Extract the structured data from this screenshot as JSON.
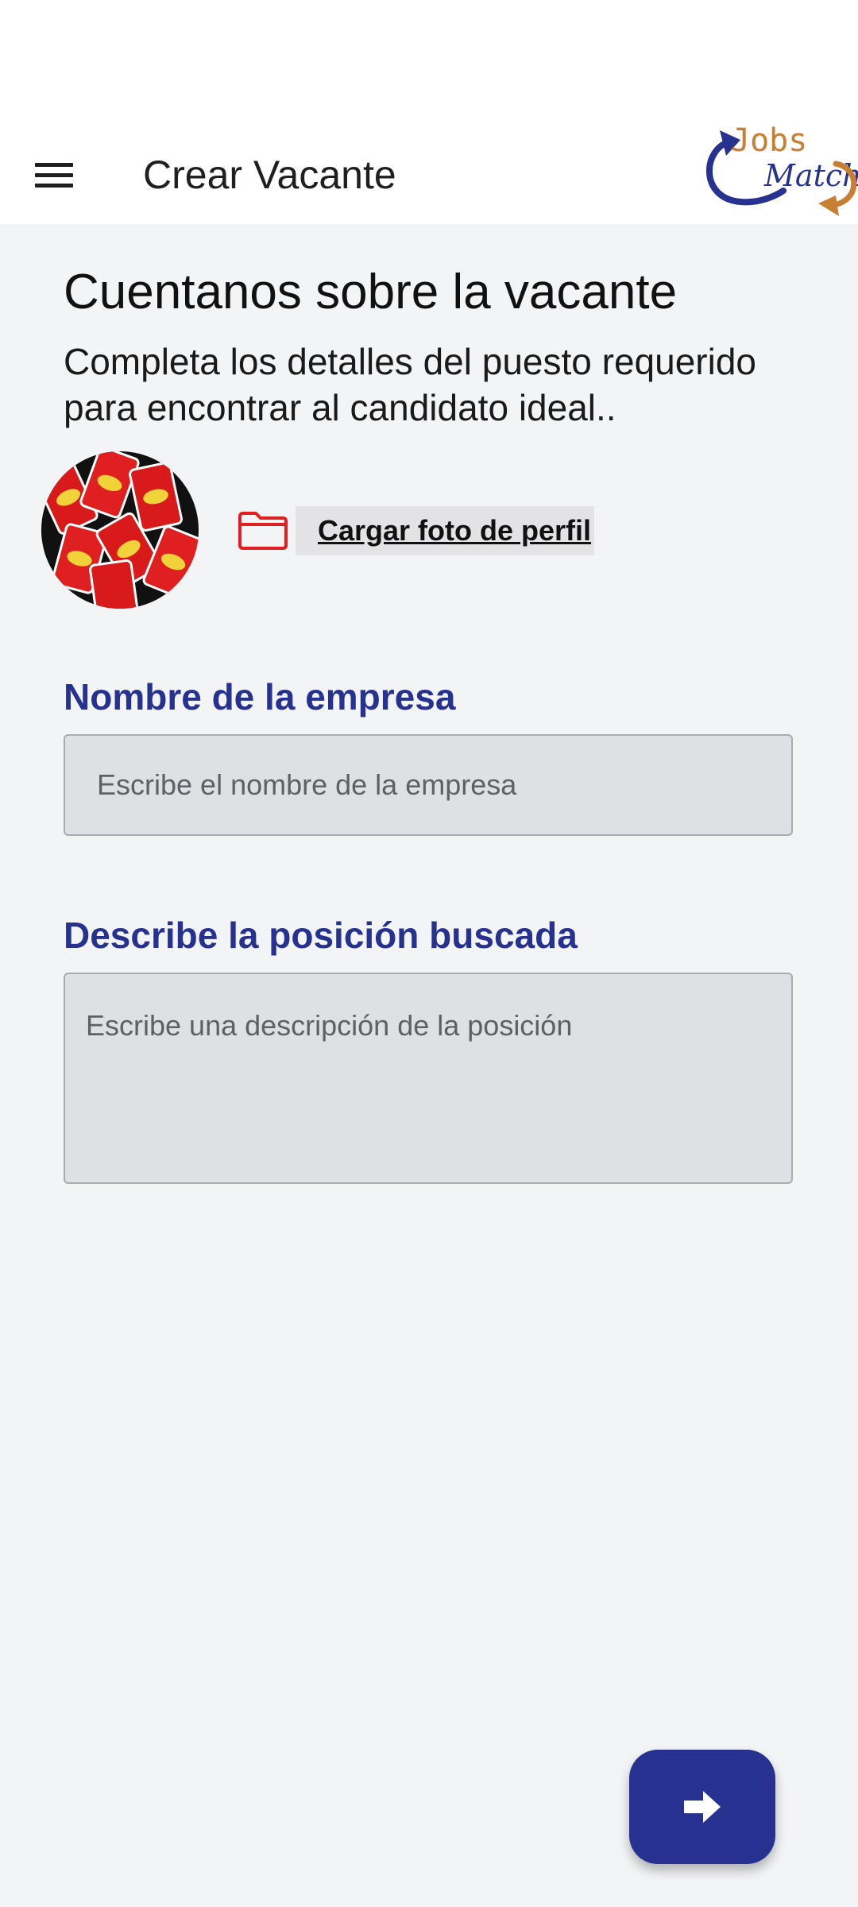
{
  "app_bar": {
    "title": "Crear Vacante",
    "menu_icon": "menu-icon",
    "logo_text_top": "Jobs",
    "logo_text_bottom": "Match"
  },
  "main": {
    "heading": "Cuentanos sobre la vacante",
    "subtitle": "Completa los detalles del puesto requerido para encontrar al candidato ideal..",
    "upload_label": "Cargar foto de perfil",
    "upload_icon": "folder-icon",
    "fields": {
      "company": {
        "label": "Nombre de la empresa",
        "placeholder": "Escribe el nombre de la empresa",
        "value": ""
      },
      "description": {
        "label": "Describe la posición buscada",
        "placeholder": "Escribe una descripción de la posición",
        "value": ""
      }
    },
    "next_icon": "arrow-right-icon"
  },
  "colors": {
    "primary": "#27318f",
    "accent_orange": "#c87f34",
    "folder_red": "#e02020",
    "background": "#f3f4f6"
  }
}
